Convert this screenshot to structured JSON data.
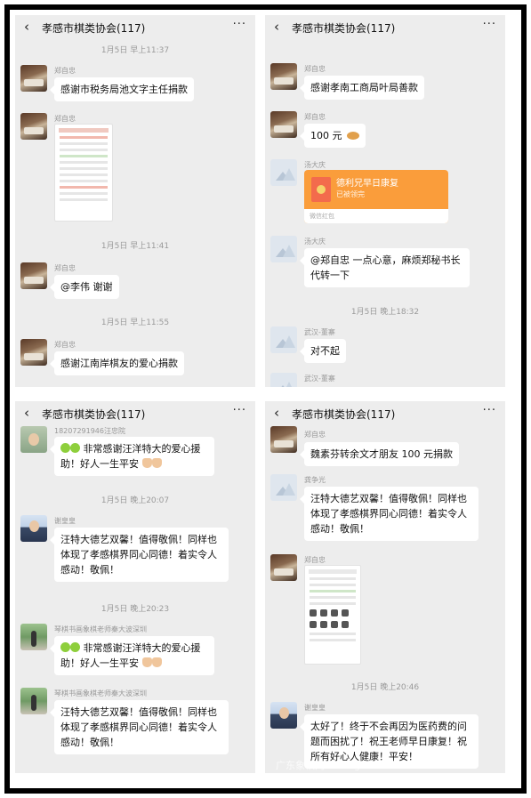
{
  "group_title": "孝感市棋类协会(117)",
  "panels": [
    {
      "items": [
        {
          "type": "time",
          "text": "1月5日 早上11:37"
        },
        {
          "type": "msg",
          "nick": "郑自忠",
          "text": "感谢市税务局池文字主任捐款"
        },
        {
          "type": "image",
          "nick": "郑自忠"
        },
        {
          "type": "time",
          "text": "1月5日 早上11:41"
        },
        {
          "type": "msg",
          "nick": "郑自忠",
          "text": "@李伟  谢谢"
        },
        {
          "type": "time",
          "text": "1月5日 早上11:55"
        },
        {
          "type": "msg",
          "nick": "郑自忠",
          "text": "感谢江南岸棋友的爱心捐款"
        }
      ]
    },
    {
      "items": [
        {
          "type": "msg",
          "nick": "郑自忠",
          "text": "感谢孝南工商局叶局善款"
        },
        {
          "type": "msg",
          "nick": "郑自忠",
          "text": "100 元"
        },
        {
          "type": "redpacket",
          "nick": "汤大庆",
          "title": "德利兄早日康复",
          "status": "已被领完",
          "footer": "微信红包"
        },
        {
          "type": "msg",
          "nick": "汤大庆",
          "text": "@郑自忠  一点心意，麻烦郑秘书长代转一下"
        },
        {
          "type": "time",
          "text": "1月5日 晚上18:32"
        },
        {
          "type": "msg",
          "nick": "武汉-董寨",
          "text": "对不起"
        },
        {
          "type": "nick_only",
          "nick": "武汉-董寨"
        }
      ]
    },
    {
      "items": [
        {
          "type": "msg",
          "nick": "18207291946汪忠院",
          "text": "非常感谢汪洋特大的爱心援助！好人一生平安"
        },
        {
          "type": "time",
          "text": "1月5日 晚上20:07"
        },
        {
          "type": "msg",
          "nick": "谢皇皇",
          "text": "汪特大德艺双馨！值得敬佩！同样也体现了孝感棋界同心同德！着实令人感动！敬佩！"
        },
        {
          "type": "time",
          "text": "1月5日 晚上20:23"
        },
        {
          "type": "msg",
          "nick": "琴棋书画象棋老师秦大波深圳",
          "text": "非常感谢汪洋特大的爱心援助！好人一生平安"
        },
        {
          "type": "msg",
          "nick": "琴棋书画象棋老师秦大波深圳",
          "text": "汪特大德艺双馨！值得敬佩！同样也体现了孝感棋界同心同德！着实令人感动！敬佩！"
        }
      ]
    },
    {
      "items": [
        {
          "type": "msg",
          "nick": "郑自忠",
          "text": "魏素芬转余文才朋友 100 元捐款"
        },
        {
          "type": "msg",
          "nick": "龚争光",
          "text": "汪特大德艺双馨！值得敬佩！同样也体现了孝感棋界同心同德！着实令人感动！敬佩！"
        },
        {
          "type": "image",
          "nick": "郑自忠"
        },
        {
          "type": "time",
          "text": "1月5日 晚上20:46"
        },
        {
          "type": "msg",
          "nick": "谢皇皇",
          "text": "太好了！终于不会再因为医药费的问题而困扰了！祝王老师早日康复！祝所有好心人健康！平安！"
        }
      ]
    }
  ],
  "watermark": "广东象棋网 www.gdchess.com"
}
